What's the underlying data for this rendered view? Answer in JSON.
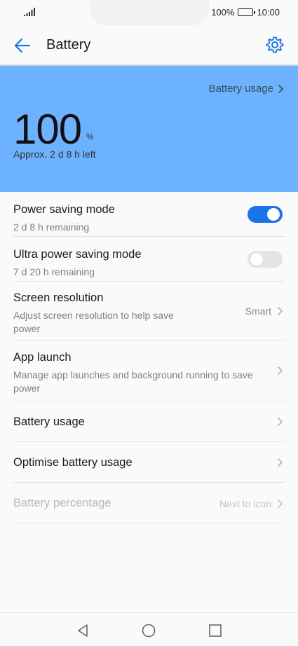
{
  "status": {
    "battery_percent": "100%",
    "time": "10:00",
    "battery_level": 1.0
  },
  "header": {
    "title": "Battery",
    "back_icon": "arrow-left-icon",
    "settings_icon": "gear-icon"
  },
  "hero": {
    "usage_link": "Battery usage",
    "percent_value": "100",
    "percent_unit": "%",
    "time_left": "Approx. 2 d 8 h left",
    "background_color": "#6cb2fe"
  },
  "settings": [
    {
      "title": "Power saving mode",
      "subtitle": "2 d 8 h remaining",
      "toggle": true
    },
    {
      "title": "Ultra power saving mode",
      "subtitle": "7 d 20 h remaining",
      "toggle": false
    },
    {
      "title": "Screen resolution",
      "subtitle": "Adjust screen resolution to help save power",
      "value": "Smart"
    },
    {
      "title": "App launch",
      "subtitle": "Manage app launches and background running to save power"
    },
    {
      "title": "Battery usage"
    },
    {
      "title": "Optimise battery usage"
    },
    {
      "title": "Battery percentage",
      "value": "Next to icon",
      "disabled": true
    }
  ],
  "nav": {
    "back_icon": "triangle-back-icon",
    "home_icon": "circle-home-icon",
    "recents_icon": "square-recents-icon"
  },
  "colors": {
    "accent": "#1a73e8",
    "toggle_off": "#e4e4e4"
  }
}
